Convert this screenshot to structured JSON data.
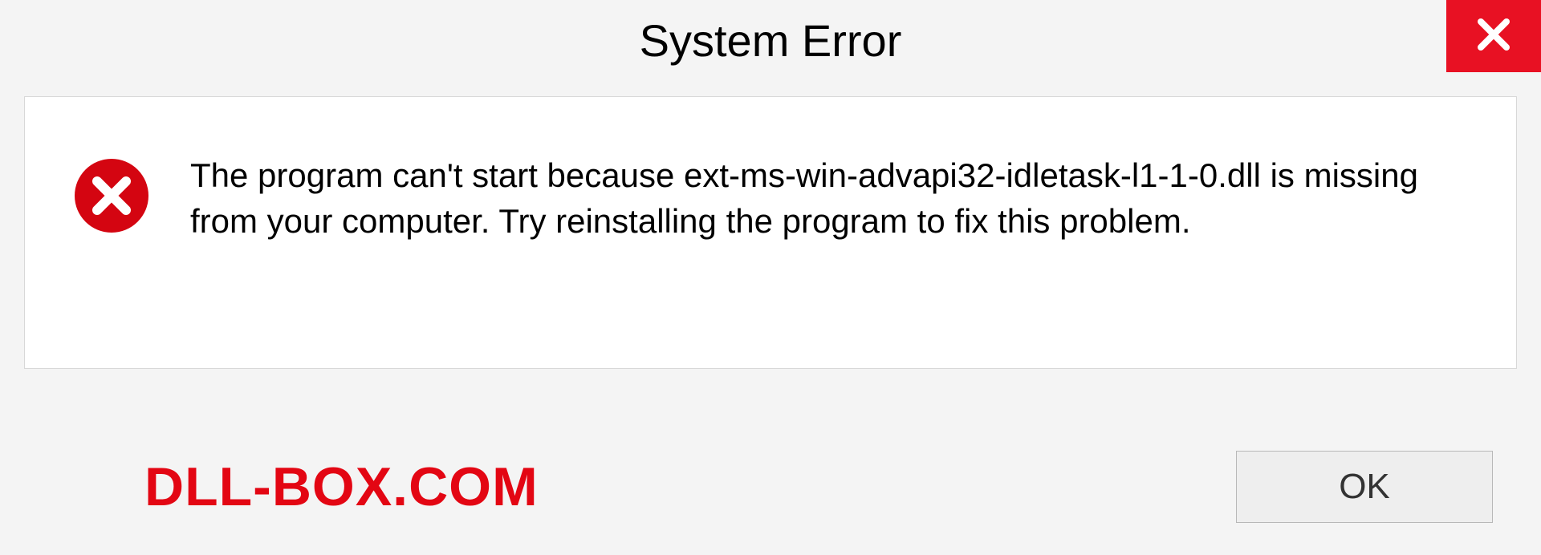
{
  "dialog": {
    "title": "System Error",
    "message": "The program can't start because ext-ms-win-advapi32-idletask-l1-1-0.dll is missing from your computer. Try reinstalling the program to fix this problem.",
    "ok_label": "OK"
  },
  "watermark": "DLL-BOX.COM",
  "colors": {
    "close_button": "#e81123",
    "error_icon": "#d40511",
    "watermark": "#e30613"
  }
}
